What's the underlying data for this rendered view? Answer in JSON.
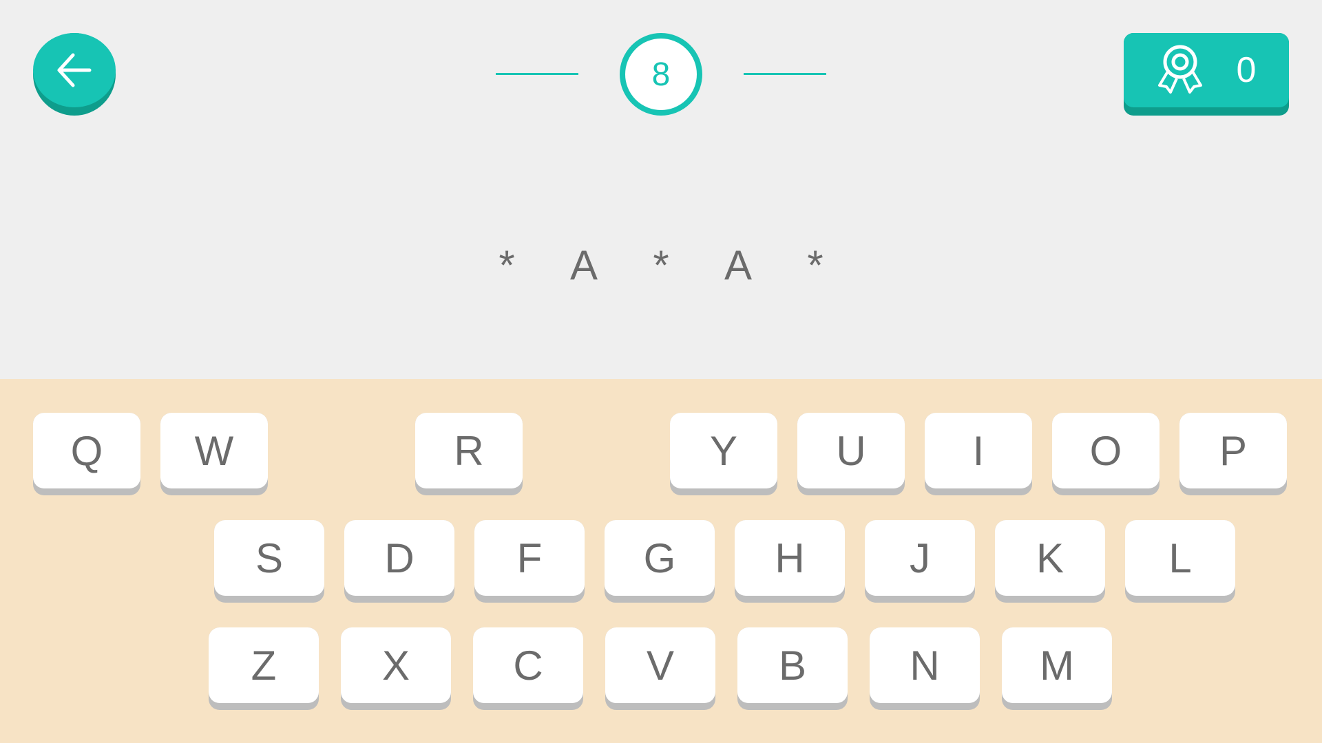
{
  "header": {
    "back_icon": "arrow-left-icon",
    "level": "8",
    "score_icon": "award-ribbon-icon",
    "score": "0"
  },
  "puzzle": {
    "letters": [
      "*",
      "A",
      "*",
      "A",
      "*"
    ]
  },
  "keyboard": {
    "row1": [
      "Q",
      "W",
      "R",
      "Y",
      "U",
      "I",
      "O",
      "P"
    ],
    "row2": [
      "S",
      "D",
      "F",
      "G",
      "H",
      "J",
      "K",
      "L"
    ],
    "row3": [
      "Z",
      "X",
      "C",
      "V",
      "B",
      "N",
      "M"
    ]
  },
  "colors": {
    "accent": "#17c4b4",
    "accent_dark": "#0e9d8c",
    "background_top": "#efefef",
    "background_keyboard": "#f7e3c5",
    "text": "#6b6b6b"
  }
}
